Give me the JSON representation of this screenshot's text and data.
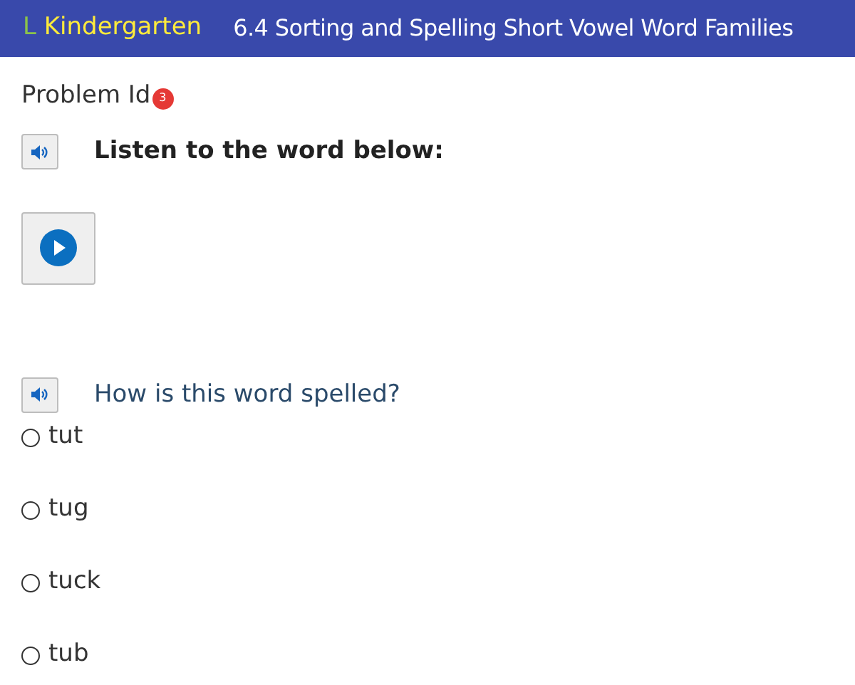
{
  "header": {
    "grade_letter": "L",
    "grade": "Kindergarten",
    "title": "6.4 Sorting and Spelling Short Vowel Word Families"
  },
  "problem": {
    "label": "Problem Id",
    "badge": "3"
  },
  "instruction": {
    "text": "Listen to the word below:"
  },
  "question": {
    "text": "How is this word spelled?"
  },
  "options": [
    {
      "label": "tut",
      "selected": false
    },
    {
      "label": "tug",
      "selected": false
    },
    {
      "label": "tuck",
      "selected": false
    },
    {
      "label": "tub",
      "selected": false
    }
  ]
}
